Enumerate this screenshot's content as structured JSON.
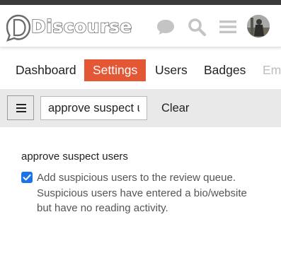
{
  "header": {
    "logo_text": "Discourse",
    "icons": [
      "chat-icon",
      "search-icon",
      "hamburger-menu-icon",
      "user-avatar"
    ]
  },
  "nav": {
    "tabs": [
      {
        "label": "Dashboard",
        "active": false
      },
      {
        "label": "Settings",
        "active": true
      },
      {
        "label": "Users",
        "active": false
      },
      {
        "label": "Badges",
        "active": false
      },
      {
        "label": "Em",
        "active": false
      }
    ]
  },
  "toolbar": {
    "filter_value": "approve suspect u",
    "clear_label": "Clear"
  },
  "setting": {
    "name": "approve suspect users",
    "checked": true,
    "description": "Add suspicious users to the review queue. Suspicious users have entered a bio/website but have no reading activity."
  },
  "colors": {
    "accent": "#e45735",
    "checkbox": "#1a73e8",
    "toolbar_bg": "#e9e9e9"
  }
}
